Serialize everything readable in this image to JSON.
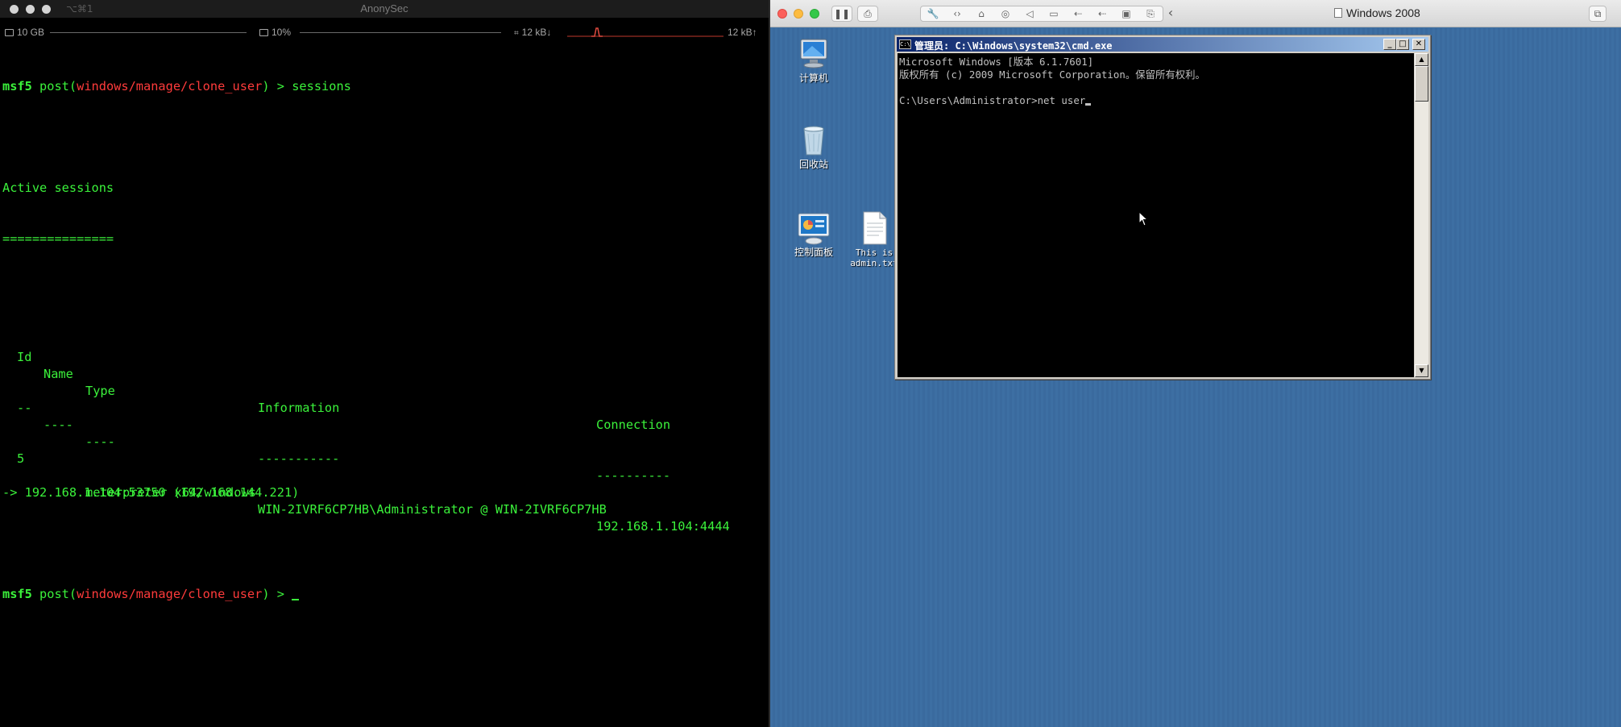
{
  "terminal": {
    "window_title": "AnonySec",
    "shortcut": "⌥⌘1",
    "status": {
      "memory": "10 GB",
      "cpu": "10%",
      "net_down": "12 kB↓",
      "net_up": "12 kB↑"
    },
    "prompt_prefix": "msf5",
    "prompt_module_open": " post(",
    "prompt_module": "windows/manage/clone_user",
    "prompt_module_close": ") > ",
    "command": "sessions",
    "active_sessions_heading": "Active sessions",
    "heading_underline": "===============",
    "table": {
      "headers": [
        "Id",
        "Name",
        "Type",
        "Information",
        "Connection"
      ],
      "underlines": [
        "--",
        "----",
        "----",
        "-----------",
        "----------"
      ],
      "rows": [
        {
          "id": "5",
          "name": "",
          "type": "meterpreter x64/windows",
          "information": "WIN-2IVRF6CP7HB\\Administrator @ WIN-2IVRF6CP7HB",
          "connection": "192.168.1.104:4444",
          "connection_cont": "-> 192.168.1.104:53750 (192.168.144.221)"
        }
      ]
    }
  },
  "vm": {
    "window_title": "Windows 2008",
    "colors": {
      "desktop": "#3d6fa3",
      "title_bar": "#0a246a"
    },
    "desktop_icons": [
      {
        "label": "计算机",
        "icon": "computer-icon"
      },
      {
        "label": "回收站",
        "icon": "recycle-bin-icon"
      },
      {
        "label": "控制面板",
        "icon": "control-panel-icon"
      },
      {
        "label_line1": "This is",
        "label_line2": "admin.txt",
        "icon": "text-file-icon"
      }
    ],
    "cmd": {
      "title": "管理员: C:\\Windows\\system32\\cmd.exe",
      "icon_text": "C:\\",
      "line1": "Microsoft Windows [版本 6.1.7601]",
      "line2": "版权所有 (c) 2009 Microsoft Corporation。保留所有权利。",
      "prompt": "C:\\Users\\Administrator>",
      "input": "net user"
    }
  }
}
